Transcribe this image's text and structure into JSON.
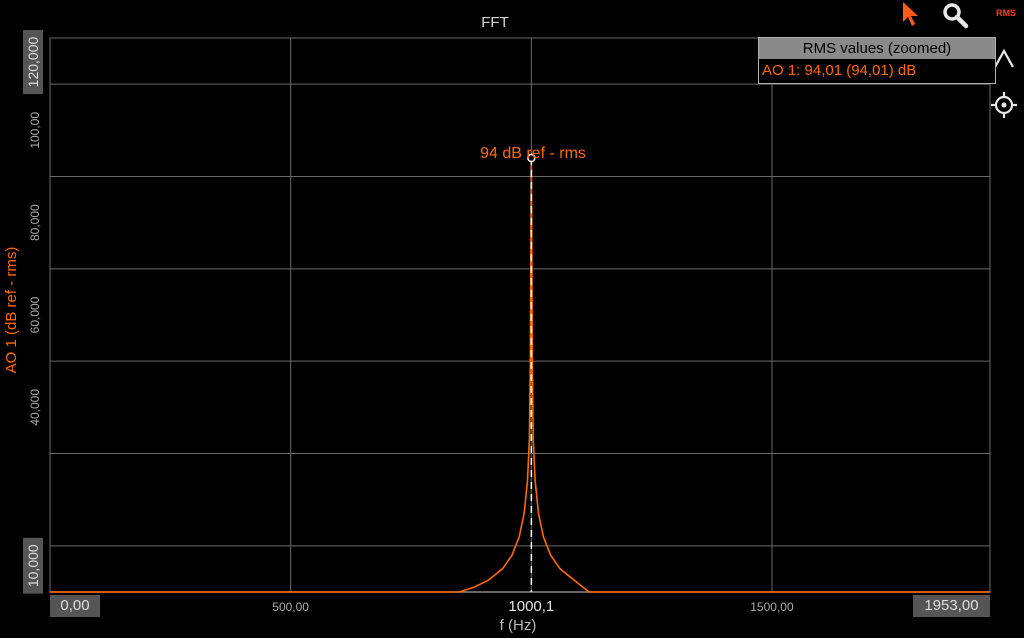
{
  "toolbar": {
    "pointer_icon": "cursor-arrow-icon",
    "zoom_icon": "magnifier-icon",
    "rms_label": "RMS",
    "collapse_icon": "chevron-up-icon",
    "crosshair_icon": "crosshair-icon"
  },
  "legend": {
    "title": "RMS values (zoomed)",
    "entry": "AO 1: 94,01 (94,01) dB"
  },
  "colors": {
    "background": "#000000",
    "grid": "#6a6a6a",
    "series": "#ff6a00",
    "text": "#d8d8d8"
  },
  "chart_data": {
    "type": "line",
    "title": "FFT",
    "xlabel": "f (Hz)",
    "ylabel": "AO 1 (dB ref - rms)",
    "xlim": [
      0,
      1953
    ],
    "ylim": [
      0,
      120
    ],
    "x_ticks": [
      {
        "value": 0,
        "label": "0,00",
        "boxed": true
      },
      {
        "value": 500,
        "label": "500,00",
        "boxed": false
      },
      {
        "value": 1000.1,
        "label": "1000,1",
        "boxed": false,
        "highlight": true
      },
      {
        "value": 1500,
        "label": "1500,00",
        "boxed": false
      },
      {
        "value": 1953,
        "label": "1953,00",
        "boxed": true
      }
    ],
    "y_ticks": [
      {
        "value": 10,
        "label": "10,000",
        "boxed": true
      },
      {
        "value": 40,
        "label": "40,000",
        "boxed": false
      },
      {
        "value": 60,
        "label": "60,000",
        "boxed": false
      },
      {
        "value": 80,
        "label": "80,000",
        "boxed": false
      },
      {
        "value": 100,
        "label": "100,00",
        "boxed": false
      },
      {
        "value": 120,
        "label": "120,000",
        "boxed": true
      }
    ],
    "x_gridlines": [
      0,
      500,
      1000,
      1500,
      1953
    ],
    "y_gridlines": [
      10,
      30,
      50,
      70,
      90,
      110
    ],
    "grid": true,
    "legend_position": "top-right",
    "series": [
      {
        "name": "AO 1",
        "x": [
          0,
          850,
          880,
          910,
          940,
          960,
          975,
          985,
          992,
          996,
          998,
          1000,
          1002,
          1004,
          1008,
          1015,
          1025,
          1040,
          1060,
          1090,
          1120,
          1953
        ],
        "y": [
          0,
          0,
          1,
          2.5,
          5,
          8,
          12,
          17,
          24,
          33,
          50,
          94,
          50,
          33,
          24,
          17,
          12,
          8,
          5,
          2.5,
          0,
          0
        ]
      }
    ],
    "marker": {
      "x": 1000.1,
      "y": 94,
      "label": "94 dB ref - rms"
    },
    "cursor_x": 1000.1
  }
}
